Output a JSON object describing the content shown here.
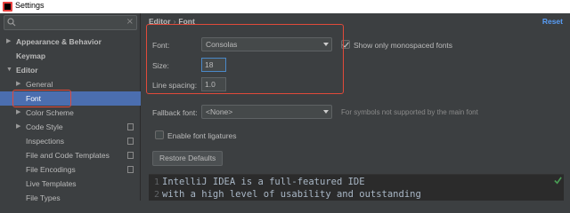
{
  "window": {
    "title": "Settings"
  },
  "search": {
    "value": "",
    "placeholder": ""
  },
  "sidebar": {
    "items": [
      {
        "label": "Appearance & Behavior"
      },
      {
        "label": "Keymap"
      },
      {
        "label": "Editor"
      },
      {
        "label": "General"
      },
      {
        "label": "Font"
      },
      {
        "label": "Color Scheme"
      },
      {
        "label": "Code Style"
      },
      {
        "label": "Inspections"
      },
      {
        "label": "File and Code Templates"
      },
      {
        "label": "File Encodings"
      },
      {
        "label": "Live Templates"
      },
      {
        "label": "File Types"
      }
    ]
  },
  "header": {
    "breadcrumb": [
      "Editor",
      "Font"
    ],
    "reset_label": "Reset"
  },
  "font": {
    "font_label": "Font:",
    "font_value": "Consolas",
    "monospace_label": "Show only monospaced fonts",
    "size_label": "Size:",
    "size_value": "18",
    "spacing_label": "Line spacing:",
    "spacing_value": "1.0",
    "fallback_label": "Fallback font:",
    "fallback_value": "<None>",
    "fallback_hint": "For symbols not supported by the main font",
    "ligatures_label": "Enable font ligatures",
    "restore_label": "Restore Defaults"
  },
  "preview": {
    "lines": [
      {
        "num": "1",
        "text": "IntelliJ IDEA is a full-featured IDE"
      },
      {
        "num": "2",
        "text": "with a high level of usability and outstanding"
      }
    ]
  }
}
